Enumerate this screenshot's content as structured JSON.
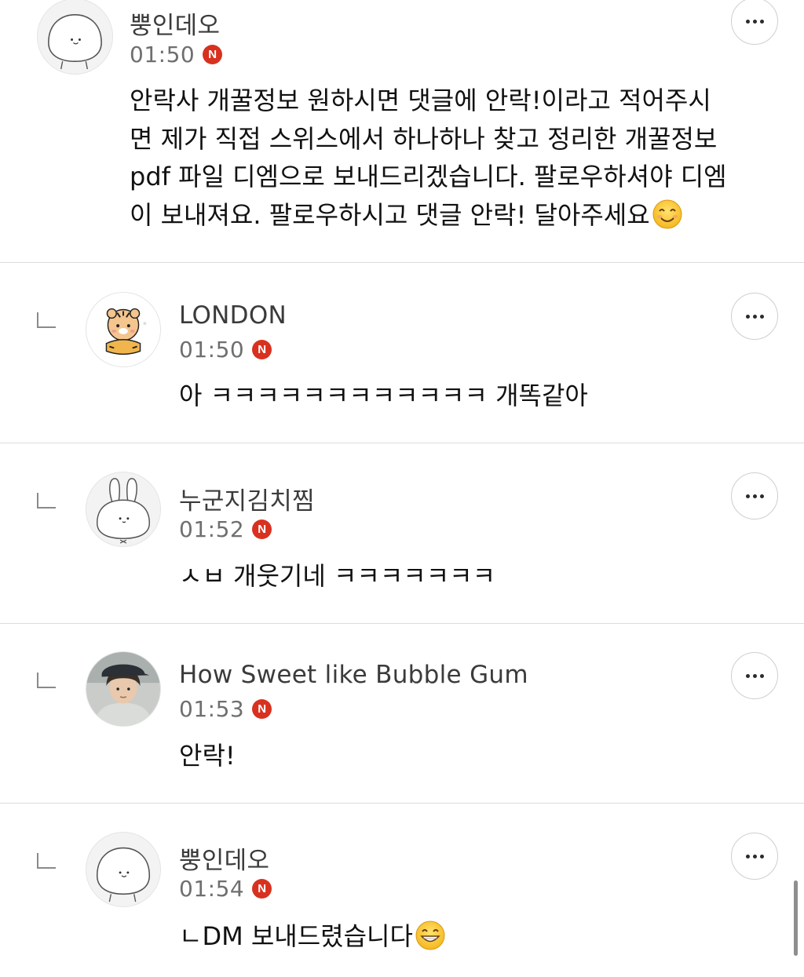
{
  "comments": [
    {
      "username": "뿡인데오",
      "time": "01:50",
      "badge": "N",
      "text": "안락사 개꿀정보 원하시면 댓글에 안락!이라고 적어주시\n면 제가 직접 스위스에서 하나하나 찾고 정리한 개꿀정보\npdf 파일 디엠으로 보내드리겠습니다. 팔로우하셔야 디엠\n이 보내져요. 팔로우하시고 댓글 안락! 달아주세요",
      "emoji": "smiling-face-icon",
      "avatar": "white-mochi-character",
      "is_reply": false
    },
    {
      "username": "LONDON",
      "time": "01:50",
      "badge": "N",
      "text": "아 ㅋㅋㅋㅋㅋㅋㅋㅋㅋㅋㅋㅋ 개똑같아",
      "avatar": "tiger-character",
      "is_reply": true
    },
    {
      "username": "누군지김치찜",
      "time": "01:52",
      "badge": "N",
      "text": "ㅅㅂ 개웃기네 ㅋㅋㅋㅋㅋㅋㅋ",
      "avatar": "white-rabbit-character",
      "is_reply": true
    },
    {
      "username": "How Sweet like Bubble Gum",
      "time": "01:53",
      "badge": "N",
      "text": "안락!",
      "avatar": "person-with-cap-photo",
      "is_reply": true
    },
    {
      "username": "뿡인데오",
      "time": "01:54",
      "badge": "N",
      "text": "ㄴDM 보내드렸습니다",
      "emoji": "grinning-face-icon",
      "avatar": "white-mochi-character",
      "is_reply": true
    }
  ],
  "colors": {
    "badge": "#d8311f",
    "divider": "#dcdcdc",
    "username": "#3b3b3b",
    "time": "#6f6f6f"
  }
}
